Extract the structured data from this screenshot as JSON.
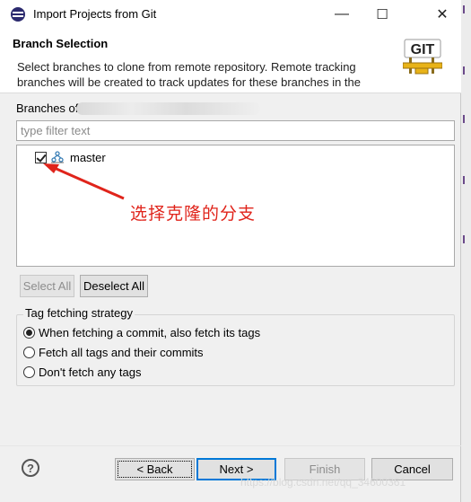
{
  "window": {
    "title": "Import Projects from Git",
    "minimize": "—",
    "maximize": "☐",
    "close": "✕"
  },
  "header": {
    "title": "Branch Selection",
    "description": "Select branches to clone from remote repository. Remote tracking branches will be created to track updates for these branches in the",
    "logo_text": "GIT"
  },
  "branches": {
    "label": "Branches of",
    "filter_placeholder": "type filter text",
    "filter_value": "",
    "items": [
      {
        "name": "master",
        "checked": true,
        "icon": "branch-icon"
      }
    ]
  },
  "annotation": {
    "text": "选择克隆的分支",
    "color": "#e0241b"
  },
  "selection_buttons": {
    "select_all": "Select All",
    "deselect_all": "Deselect All"
  },
  "tag_strategy": {
    "title": "Tag fetching strategy",
    "options": [
      {
        "label": "When fetching a commit, also fetch its tags",
        "selected": true
      },
      {
        "label": "Fetch all tags and their commits",
        "selected": false
      },
      {
        "label": "Don't fetch any tags",
        "selected": false
      }
    ]
  },
  "footer": {
    "help_icon": "help-icon",
    "back": "< Back",
    "next": "Next >",
    "finish": "Finish",
    "cancel": "Cancel"
  },
  "watermark": "https://blog.csdn.net/qq_34600361",
  "colors": {
    "accent": "#0078d7",
    "annotation": "#e0241b",
    "dialog_bg": "#f0f0f0"
  }
}
